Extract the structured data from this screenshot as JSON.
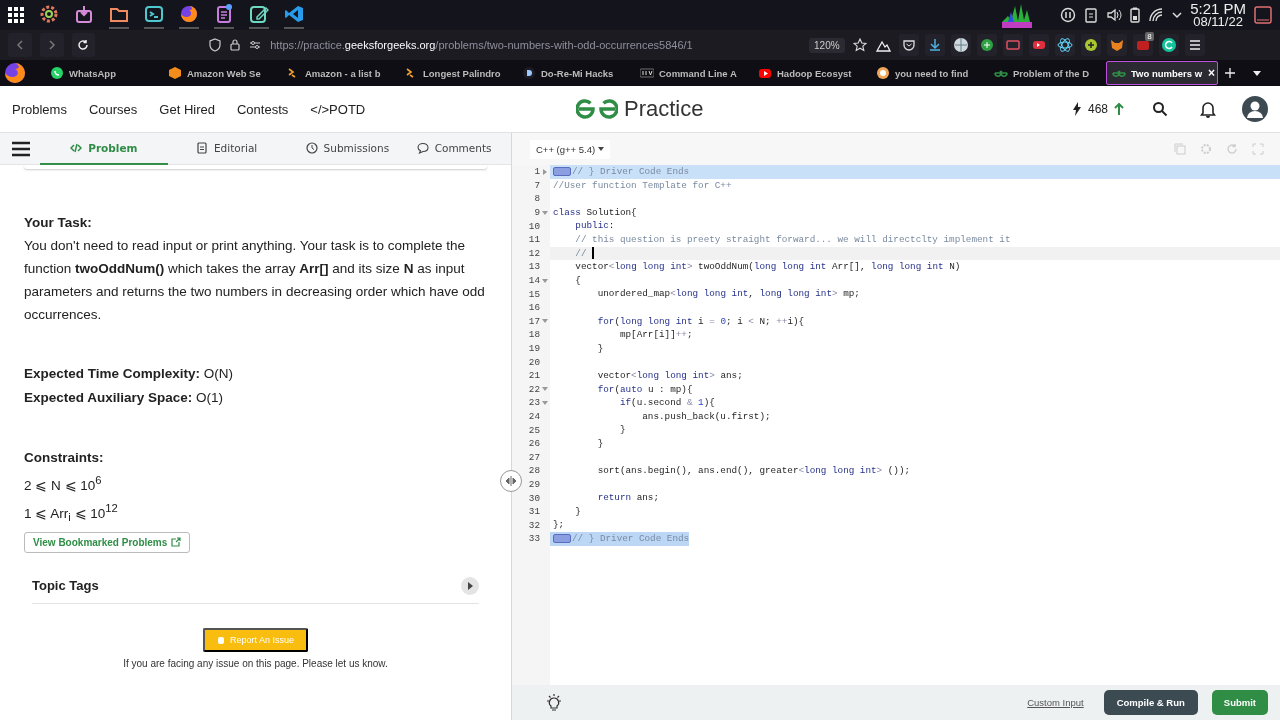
{
  "taskbar": {
    "time": "5:21 PM",
    "date": "08/11/22"
  },
  "browser": {
    "url": "https://practice.**geeksforgeeks.org**/problems/two-numbers-with-odd-occurrences5846/1",
    "zoom": "120%",
    "extension_badge": "8",
    "tab_close": "×",
    "tabs": [
      {
        "label": "WhatsApp",
        "selected": false
      },
      {
        "label": "Amazon Web Se",
        "selected": false
      },
      {
        "label": "Amazon - a list b",
        "selected": false
      },
      {
        "label": "Longest Palindro",
        "selected": false
      },
      {
        "label": "Do-Re-Mi Hacks",
        "selected": false
      },
      {
        "label": "Command Line A",
        "selected": false
      },
      {
        "label": "Hadoop Ecosyst",
        "selected": false
      },
      {
        "label": "you need to find",
        "selected": false
      },
      {
        "label": "Problem of the D",
        "selected": false
      },
      {
        "label": "Two numbers w",
        "selected": true
      }
    ]
  },
  "header": {
    "nav": [
      "Problems",
      "Courses",
      "Get Hired",
      "Contests",
      "</>POTD"
    ],
    "logo": "Practice",
    "score": "468"
  },
  "problem": {
    "tabs": [
      {
        "label": "Problem",
        "selected": true
      },
      {
        "label": "Editorial",
        "selected": false
      },
      {
        "label": "Submissions",
        "selected": false
      },
      {
        "label": "Comments",
        "selected": false
      }
    ],
    "task_heading": "Your Task:",
    "task_text": "You don't need to read input or print anything. Your task is to complete the function **twoOddNum()** which takes the array **Arr[]** and its size **N** as input parameters and returns the two numbers in decreasing order which have odd occurrences.",
    "complexity": [
      "**Expected Time Complexity:** O(N)",
      "**Expected Auxiliary Space:** O(1)"
    ],
    "constraints_heading": "Constraints:",
    "constraints": [
      "2 ⩽ N ⩽ 10$^{6}$",
      "1 ⩽ Arr$_{i}$ ⩽ 10$^{12}$"
    ],
    "bookmark_button": "View Bookmarked Problems",
    "topic_tags": "Topic Tags",
    "report_button": "Report An Issue",
    "report_note": "If you are facing any issue on this page. Please let us know."
  },
  "editor": {
    "language": "C++ (g++ 5.4)",
    "lines": [
      {
        "number": "1",
        "fold_arrow": true,
        "folded": true,
        "selected": true,
        "selection_past_end": true,
        "cursor": false,
        "segments": [
          {
            "kind": "comment",
            "text": "// } Driver Code Ends"
          }
        ]
      },
      {
        "number": "7",
        "fold_arrow": false,
        "folded": false,
        "selected": false,
        "selection_past_end": false,
        "cursor": false,
        "segments": [
          {
            "kind": "comment",
            "text": "//User function Template for C++"
          }
        ]
      },
      {
        "number": "8",
        "fold_arrow": false,
        "folded": false,
        "selected": false,
        "selection_past_end": false,
        "cursor": false
      },
      {
        "number": "9",
        "fold_arrow": true,
        "folded": false,
        "selected": false,
        "selection_past_end": false,
        "cursor": false,
        "segments": [
          {
            "kind": "keyword",
            "text": "class"
          },
          {
            "kind": "plain",
            "text": " Solution{"
          }
        ]
      },
      {
        "number": "10",
        "fold_arrow": false,
        "folded": false,
        "selected": false,
        "selection_past_end": false,
        "cursor": false,
        "segments": [
          {
            "kind": "keyword",
            "text": "    public"
          },
          {
            "kind": "plain",
            "text": ":"
          }
        ]
      },
      {
        "number": "11",
        "fold_arrow": false,
        "folded": false,
        "selected": false,
        "selection_past_end": false,
        "cursor": false,
        "segments": [
          {
            "kind": "comment",
            "text": "    // this question is preety straight forward... we will directclty implement it"
          }
        ]
      },
      {
        "number": "12",
        "fold_arrow": false,
        "folded": false,
        "selected": false,
        "selection_past_end": false,
        "cursor": true,
        "segments": [
          {
            "kind": "comment",
            "text": "    // "
          }
        ]
      },
      {
        "number": "13",
        "fold_arrow": false,
        "folded": false,
        "selected": false,
        "selection_past_end": false,
        "cursor": false,
        "segments": [
          {
            "kind": "plain",
            "text": "    vector"
          },
          {
            "kind": "operator",
            "text": "<"
          },
          {
            "kind": "keyword",
            "text": "long long int"
          },
          {
            "kind": "operator",
            "text": ">"
          },
          {
            "kind": "plain",
            "text": " twoOddNum("
          },
          {
            "kind": "keyword",
            "text": "long long int"
          },
          {
            "kind": "plain",
            "text": " Arr[], "
          },
          {
            "kind": "keyword",
            "text": "long long int"
          },
          {
            "kind": "plain",
            "text": " N)"
          }
        ]
      },
      {
        "number": "14",
        "fold_arrow": true,
        "folded": false,
        "selected": false,
        "selection_past_end": false,
        "cursor": false,
        "segments": [
          {
            "kind": "plain",
            "text": "    {"
          }
        ]
      },
      {
        "number": "15",
        "fold_arrow": false,
        "folded": false,
        "selected": false,
        "selection_past_end": false,
        "cursor": false,
        "segments": [
          {
            "kind": "plain",
            "text": "        unordered_map"
          },
          {
            "kind": "operator",
            "text": "<"
          },
          {
            "kind": "keyword",
            "text": "long long int"
          },
          {
            "kind": "plain",
            "text": ", "
          },
          {
            "kind": "keyword",
            "text": "long long int"
          },
          {
            "kind": "operator",
            "text": ">"
          },
          {
            "kind": "plain",
            "text": " mp;"
          }
        ]
      },
      {
        "number": "16",
        "fold_arrow": false,
        "folded": false,
        "selected": false,
        "selection_past_end": false,
        "cursor": false
      },
      {
        "number": "17",
        "fold_arrow": true,
        "folded": false,
        "selected": false,
        "selection_past_end": false,
        "cursor": false,
        "segments": [
          {
            "kind": "keyword",
            "text": "        for"
          },
          {
            "kind": "plain",
            "text": "("
          },
          {
            "kind": "keyword",
            "text": "long long int"
          },
          {
            "kind": "plain",
            "text": " i "
          },
          {
            "kind": "operator",
            "text": "="
          },
          {
            "kind": "number",
            "text": " 0"
          },
          {
            "kind": "plain",
            "text": "; i "
          },
          {
            "kind": "operator",
            "text": "<"
          },
          {
            "kind": "plain",
            "text": " N; "
          },
          {
            "kind": "operator",
            "text": "++"
          },
          {
            "kind": "plain",
            "text": "i){"
          }
        ]
      },
      {
        "number": "18",
        "fold_arrow": false,
        "folded": false,
        "selected": false,
        "selection_past_end": false,
        "cursor": false,
        "segments": [
          {
            "kind": "plain",
            "text": "            mp[Arr[i]]"
          },
          {
            "kind": "operator",
            "text": "++"
          },
          {
            "kind": "plain",
            "text": ";"
          }
        ]
      },
      {
        "number": "19",
        "fold_arrow": false,
        "folded": false,
        "selected": false,
        "selection_past_end": false,
        "cursor": false,
        "segments": [
          {
            "kind": "plain",
            "text": "        }"
          }
        ]
      },
      {
        "number": "20",
        "fold_arrow": false,
        "folded": false,
        "selected": false,
        "selection_past_end": false,
        "cursor": false
      },
      {
        "number": "21",
        "fold_arrow": false,
        "folded": false,
        "selected": false,
        "selection_past_end": false,
        "cursor": false,
        "segments": [
          {
            "kind": "plain",
            "text": "        vector"
          },
          {
            "kind": "operator",
            "text": "<"
          },
          {
            "kind": "keyword",
            "text": "long long int"
          },
          {
            "kind": "operator",
            "text": ">"
          },
          {
            "kind": "plain",
            "text": " ans;"
          }
        ]
      },
      {
        "number": "22",
        "fold_arrow": true,
        "folded": false,
        "selected": false,
        "selection_past_end": false,
        "cursor": false,
        "segments": [
          {
            "kind": "keyword",
            "text": "        for"
          },
          {
            "kind": "plain",
            "text": "("
          },
          {
            "kind": "keyword",
            "text": "auto"
          },
          {
            "kind": "plain",
            "text": " u : mp){"
          }
        ]
      },
      {
        "number": "23",
        "fold_arrow": true,
        "folded": false,
        "selected": false,
        "selection_past_end": false,
        "cursor": false,
        "segments": [
          {
            "kind": "keyword",
            "text": "            if"
          },
          {
            "kind": "plain",
            "text": "(u.second "
          },
          {
            "kind": "operator",
            "text": "&"
          },
          {
            "kind": "number",
            "text": " 1"
          },
          {
            "kind": "plain",
            "text": "){"
          }
        ]
      },
      {
        "number": "24",
        "fold_arrow": false,
        "folded": false,
        "selected": false,
        "selection_past_end": false,
        "cursor": false,
        "segments": [
          {
            "kind": "plain",
            "text": "                ans.push_back(u.first);"
          }
        ]
      },
      {
        "number": "25",
        "fold_arrow": false,
        "folded": false,
        "selected": false,
        "selection_past_end": false,
        "cursor": false,
        "segments": [
          {
            "kind": "plain",
            "text": "            }"
          }
        ]
      },
      {
        "number": "26",
        "fold_arrow": false,
        "folded": false,
        "selected": false,
        "selection_past_end": false,
        "cursor": false,
        "segments": [
          {
            "kind": "plain",
            "text": "        }"
          }
        ]
      },
      {
        "number": "27",
        "fold_arrow": false,
        "folded": false,
        "selected": false,
        "selection_past_end": false,
        "cursor": false
      },
      {
        "number": "28",
        "fold_arrow": false,
        "folded": false,
        "selected": false,
        "selection_past_end": false,
        "cursor": false,
        "segments": [
          {
            "kind": "plain",
            "text": "        sort(ans.begin(), ans.end(), greater"
          },
          {
            "kind": "operator",
            "text": "<"
          },
          {
            "kind": "keyword",
            "text": "long long int"
          },
          {
            "kind": "operator",
            "text": ">"
          },
          {
            "kind": "plain",
            "text": " ());"
          }
        ]
      },
      {
        "number": "29",
        "fold_arrow": false,
        "folded": false,
        "selected": false,
        "selection_past_end": false,
        "cursor": false
      },
      {
        "number": "30",
        "fold_arrow": false,
        "folded": false,
        "selected": false,
        "selection_past_end": false,
        "cursor": false,
        "segments": [
          {
            "kind": "keyword",
            "text": "        return"
          },
          {
            "kind": "plain",
            "text": " ans;"
          }
        ]
      },
      {
        "number": "31",
        "fold_arrow": false,
        "folded": false,
        "selected": false,
        "selection_past_end": false,
        "cursor": false,
        "segments": [
          {
            "kind": "plain",
            "text": "    }"
          }
        ]
      },
      {
        "number": "32",
        "fold_arrow": false,
        "folded": false,
        "selected": false,
        "selection_past_end": false,
        "cursor": false,
        "segments": [
          {
            "kind": "plain",
            "text": "};"
          }
        ]
      },
      {
        "number": "33",
        "fold_arrow": false,
        "folded": true,
        "selected": true,
        "selection_past_end": false,
        "cursor": false,
        "segments": [
          {
            "kind": "comment",
            "text": "// } Driver Code Ends"
          }
        ]
      }
    ],
    "custom_input": "Custom Input",
    "buttons": [
      "Compile & Run",
      "Submit"
    ]
  }
}
